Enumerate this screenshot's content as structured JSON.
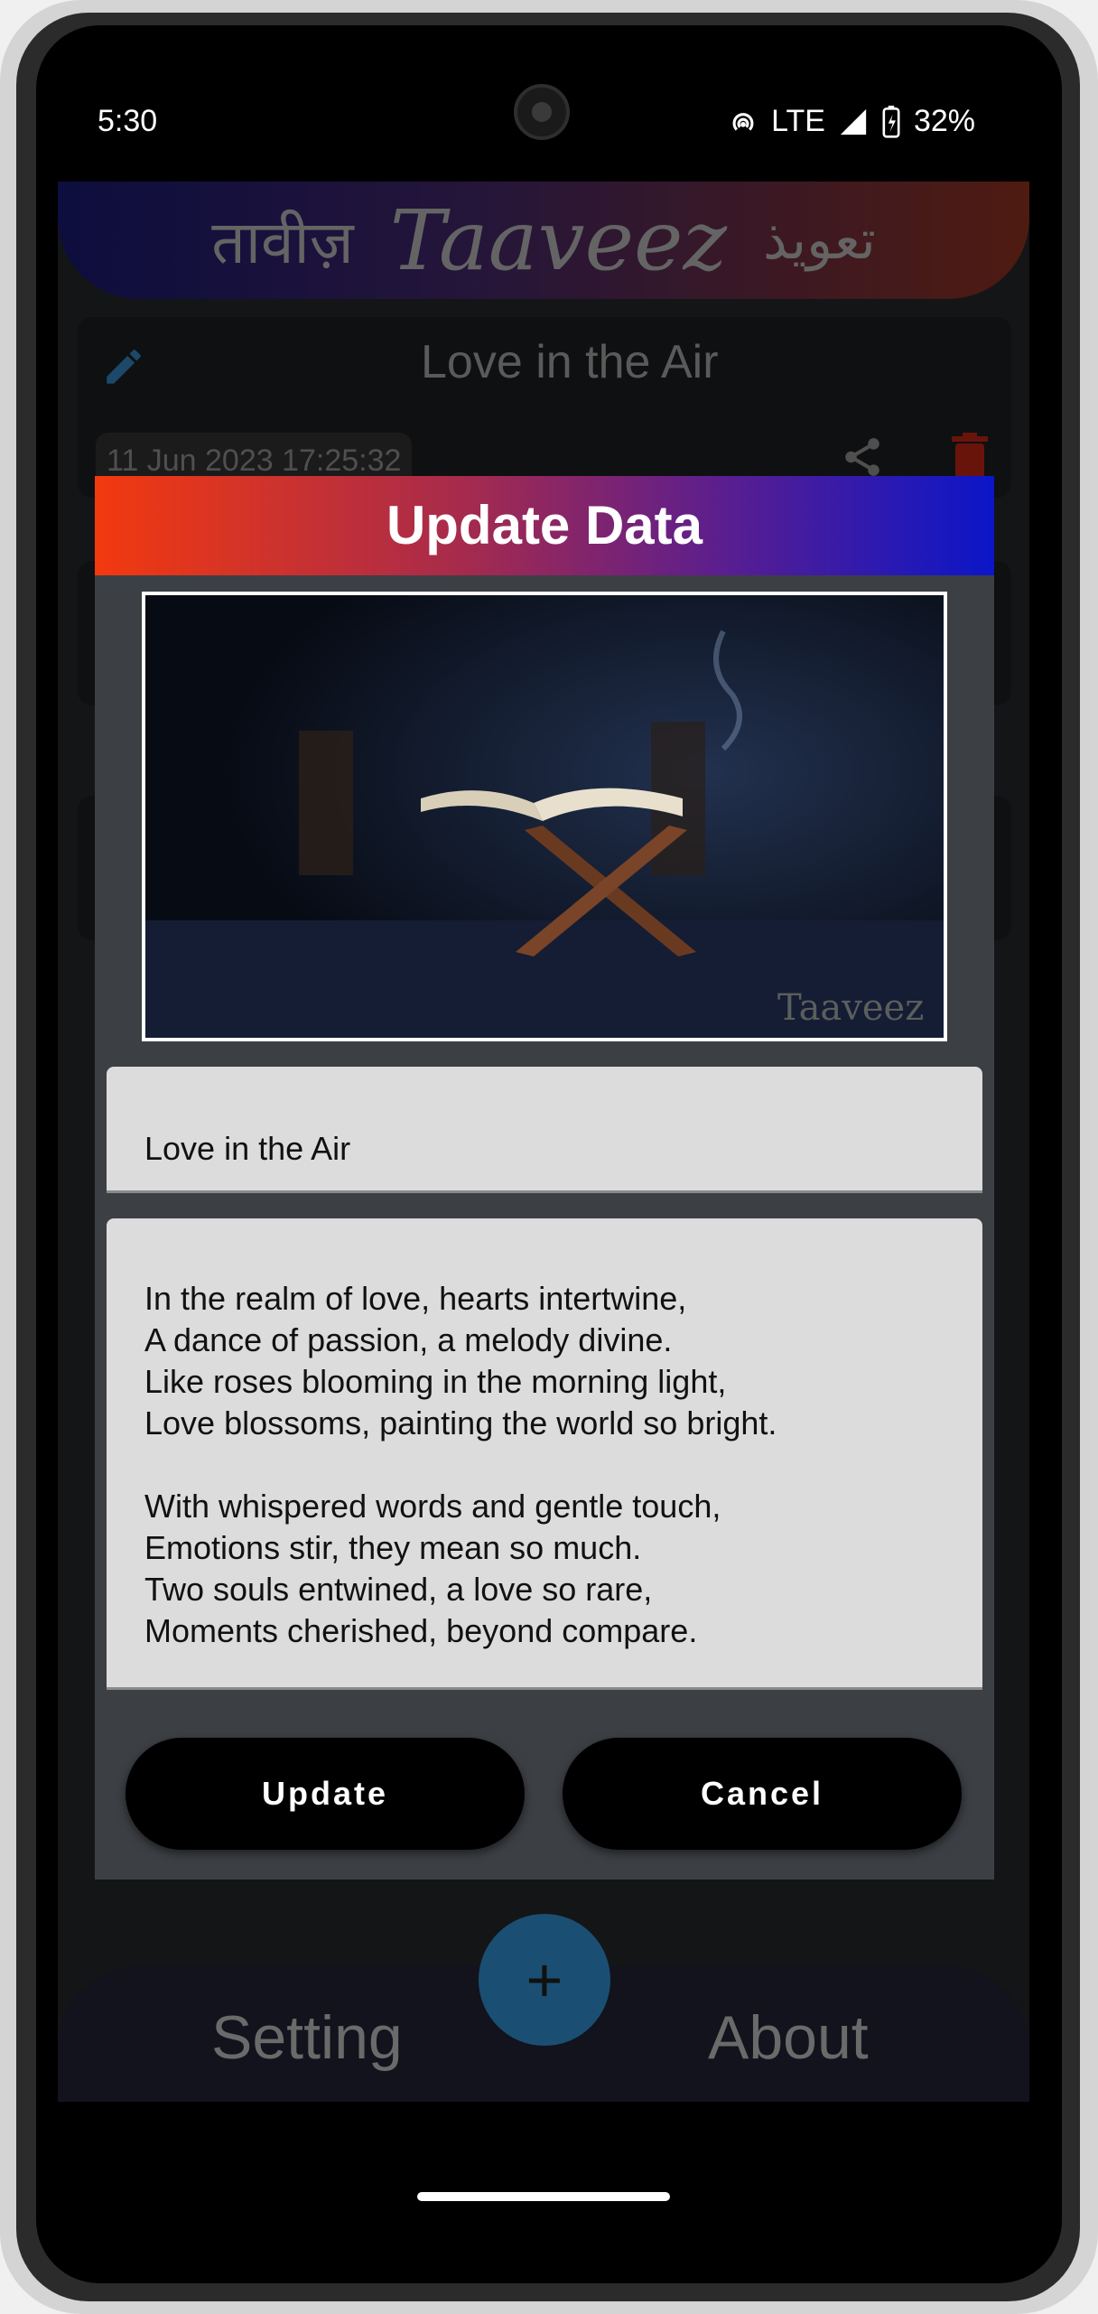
{
  "status_bar": {
    "time": "5:30",
    "network": "LTE",
    "battery": "32%"
  },
  "banner": {
    "hindi": "तावीज़",
    "latin": "Taaveez",
    "urdu": "تعویذ"
  },
  "background_card": {
    "title": "Love in the Air",
    "timestamp": "11 Jun 2023 17:25:32"
  },
  "dialog": {
    "title": "Update Data",
    "image_watermark": "Taaveez",
    "title_value": "Love in the Air",
    "body_lines": [
      "In the realm of love, hearts intertwine,",
      "A dance of passion, a melody divine.",
      "Like roses blooming in the morning light,",
      "Love blossoms, painting the world so bright.",
      "",
      "With whispered words and gentle touch,",
      "Emotions stir, they mean so much.",
      "Two souls entwined, a love so rare,",
      "Moments cherished, beyond compare."
    ],
    "update_label": "Update",
    "cancel_label": "Cancel"
  },
  "bottom_nav": {
    "setting": "Setting",
    "about": "About",
    "fab": "+"
  },
  "colors": {
    "accent_blue": "#2b7bb8",
    "delete_red": "#a11f12"
  }
}
